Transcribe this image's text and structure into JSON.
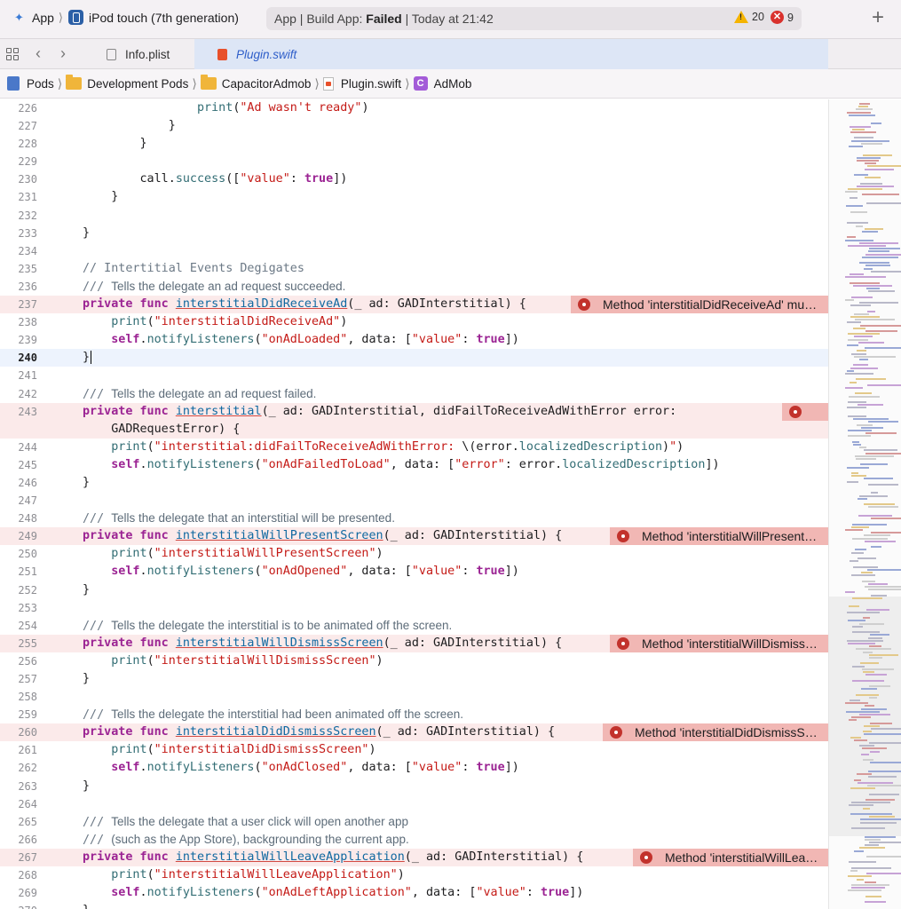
{
  "toolbar": {
    "scheme": "App",
    "device": "iPod touch (7th generation)",
    "activity_prefix": "App | Build App: ",
    "activity_status": "Failed",
    "activity_suffix": " | Today at 21:42",
    "warning_count": "20",
    "error_count": "9",
    "add_label": "+"
  },
  "tabs": [
    {
      "label": "Info.plist",
      "active": false
    },
    {
      "label": "Plugin.swift",
      "active": true
    }
  ],
  "jumpbar": [
    "Pods",
    "Development Pods",
    "CapacitorAdmob",
    "Plugin.swift",
    "AdMob"
  ],
  "editor": {
    "current_line": 240,
    "lines": [
      {
        "n": "226",
        "html": "                <span class=\"fn\">print</span>(<span class=\"str\">\"Ad wasn't ready\"</span>)"
      },
      {
        "n": "227",
        "html": "            }"
      },
      {
        "n": "228",
        "html": "        }"
      },
      {
        "n": "229",
        "html": ""
      },
      {
        "n": "230",
        "html": "        call.<span class=\"fn\">success</span>([<span class=\"str\">\"value\"</span>: <span class=\"kw\">true</span>])"
      },
      {
        "n": "231",
        "html": "    }"
      },
      {
        "n": "232",
        "html": ""
      },
      {
        "n": "233",
        "html": "}"
      },
      {
        "n": "234",
        "html": ""
      },
      {
        "n": "235",
        "html": "<span class=\"cm\">// Intertitial Events Degigates</span>"
      },
      {
        "n": "236",
        "html": "<span class=\"cm\">/// </span><span class=\"doc\">Tells the delegate an ad request succeeded.</span>"
      },
      {
        "n": "237",
        "err": true,
        "badge": "Method 'interstitialDidReceiveAd' mu…",
        "badgeWidth": 290,
        "html": "<span class=\"kw\">private func</span> <span class=\"decl decl-ul\">interstitialDidReceiveAd</span>(_ ad: GADInterstitial) {"
      },
      {
        "n": "238",
        "html": "    <span class=\"fn\">print</span>(<span class=\"str\">\"interstitialDidReceiveAd\"</span>)"
      },
      {
        "n": "239",
        "html": "    <span class=\"kw\">self</span>.<span class=\"fn\">notifyListeners</span>(<span class=\"str\">\"onAdLoaded\"</span>, data: [<span class=\"str\">\"value\"</span>: <span class=\"kw\">true</span>])"
      },
      {
        "n": "240",
        "cur": true,
        "html": "}<span class=\"cursor\"></span>"
      },
      {
        "n": "241",
        "html": ""
      },
      {
        "n": "242",
        "html": "<span class=\"cm\">/// </span><span class=\"doc\">Tells the delegate an ad request failed.</span>"
      },
      {
        "n": "243",
        "err": true,
        "badge": "",
        "badgeWidth": 52,
        "html": "<span class=\"kw\">private func</span> <span class=\"decl decl-ul\">interstitial</span>(_ ad: GADInterstitial, didFailToReceiveAdWithError error:"
      },
      {
        "n": "",
        "err": true,
        "html": "    GADRequestError) {"
      },
      {
        "n": "244",
        "html": "    <span class=\"fn\">print</span>(<span class=\"str\">\"interstitial:didFailToReceiveAdWithError: </span>\\(error.<span class=\"fn\">localizedDescription</span>)<span class=\"str\">\"</span>)"
      },
      {
        "n": "245",
        "html": "    <span class=\"kw\">self</span>.<span class=\"fn\">notifyListeners</span>(<span class=\"str\">\"onAdFailedToLoad\"</span>, data: [<span class=\"str\">\"error\"</span>: error.<span class=\"fn\">localizedDescription</span>])"
      },
      {
        "n": "246",
        "html": "}"
      },
      {
        "n": "247",
        "html": ""
      },
      {
        "n": "248",
        "html": "<span class=\"cm\">/// </span><span class=\"doc\">Tells the delegate that an interstitial will be presented.</span>"
      },
      {
        "n": "249",
        "err": true,
        "badge": "Method 'interstitialWillPresent…",
        "badgeWidth": 246,
        "html": "<span class=\"kw\">private func</span> <span class=\"decl decl-ul\">interstitialWillPresentScreen</span>(_ ad: GADInterstitial) {"
      },
      {
        "n": "250",
        "html": "    <span class=\"fn\">print</span>(<span class=\"str\">\"interstitialWillPresentScreen\"</span>)"
      },
      {
        "n": "251",
        "html": "    <span class=\"kw\">self</span>.<span class=\"fn\">notifyListeners</span>(<span class=\"str\">\"onAdOpened\"</span>, data: [<span class=\"str\">\"value\"</span>: <span class=\"kw\">true</span>])"
      },
      {
        "n": "252",
        "html": "}"
      },
      {
        "n": "253",
        "html": ""
      },
      {
        "n": "254",
        "html": "<span class=\"cm\">/// </span><span class=\"doc\">Tells the delegate the interstitial is to be animated off the screen.</span>"
      },
      {
        "n": "255",
        "err": true,
        "badge": "Method 'interstitialWillDismiss…",
        "badgeWidth": 246,
        "html": "<span class=\"kw\">private func</span> <span class=\"decl decl-ul\">interstitialWillDismissScreen</span>(_ ad: GADInterstitial) {"
      },
      {
        "n": "256",
        "html": "    <span class=\"fn\">print</span>(<span class=\"str\">\"interstitialWillDismissScreen\"</span>)"
      },
      {
        "n": "257",
        "html": "}"
      },
      {
        "n": "258",
        "html": ""
      },
      {
        "n": "259",
        "html": "<span class=\"cm\">/// </span><span class=\"doc\">Tells the delegate the interstitial had been animated off the screen.</span>"
      },
      {
        "n": "260",
        "err": true,
        "badge": "Method 'interstitialDidDismissS…",
        "badgeWidth": 254,
        "html": "<span class=\"kw\">private func</span> <span class=\"decl decl-ul\">interstitialDidDismissScreen</span>(_ ad: GADInterstitial) {"
      },
      {
        "n": "261",
        "html": "    <span class=\"fn\">print</span>(<span class=\"str\">\"interstitialDidDismissScreen\"</span>)"
      },
      {
        "n": "262",
        "html": "    <span class=\"kw\">self</span>.<span class=\"fn\">notifyListeners</span>(<span class=\"str\">\"onAdClosed\"</span>, data: [<span class=\"str\">\"value\"</span>: <span class=\"kw\">true</span>])"
      },
      {
        "n": "263",
        "html": "}"
      },
      {
        "n": "264",
        "html": ""
      },
      {
        "n": "265",
        "html": "<span class=\"cm\">/// </span><span class=\"doc\">Tells the delegate that a user click will open another app</span>"
      },
      {
        "n": "266",
        "html": "<span class=\"cm\">/// </span><span class=\"doc\">(such as the App Store), backgrounding the current app.</span>"
      },
      {
        "n": "267",
        "err": true,
        "badge": "Method 'interstitialWillLea…",
        "badgeWidth": 220,
        "html": "<span class=\"kw\">private func</span> <span class=\"decl decl-ul\">interstitialWillLeaveApplication</span>(_ ad: GADInterstitial) {"
      },
      {
        "n": "268",
        "html": "    <span class=\"fn\">print</span>(<span class=\"str\">\"interstitialWillLeaveApplication\"</span>)"
      },
      {
        "n": "269",
        "html": "    <span class=\"kw\">self</span>.<span class=\"fn\">notifyListeners</span>(<span class=\"str\">\"onAdLeftApplication\"</span>, data: [<span class=\"str\">\"value\"</span>: <span class=\"kw\">true</span>])"
      },
      {
        "n": "270",
        "html": "}"
      }
    ]
  },
  "colors": {
    "keyword": "#9b2393",
    "string": "#c41a16",
    "function": "#326d74",
    "declaration": "#0f68a0",
    "error_line": "#fbeaea",
    "error_badge": "#f1b7b4",
    "current_line": "#edf3fd"
  }
}
